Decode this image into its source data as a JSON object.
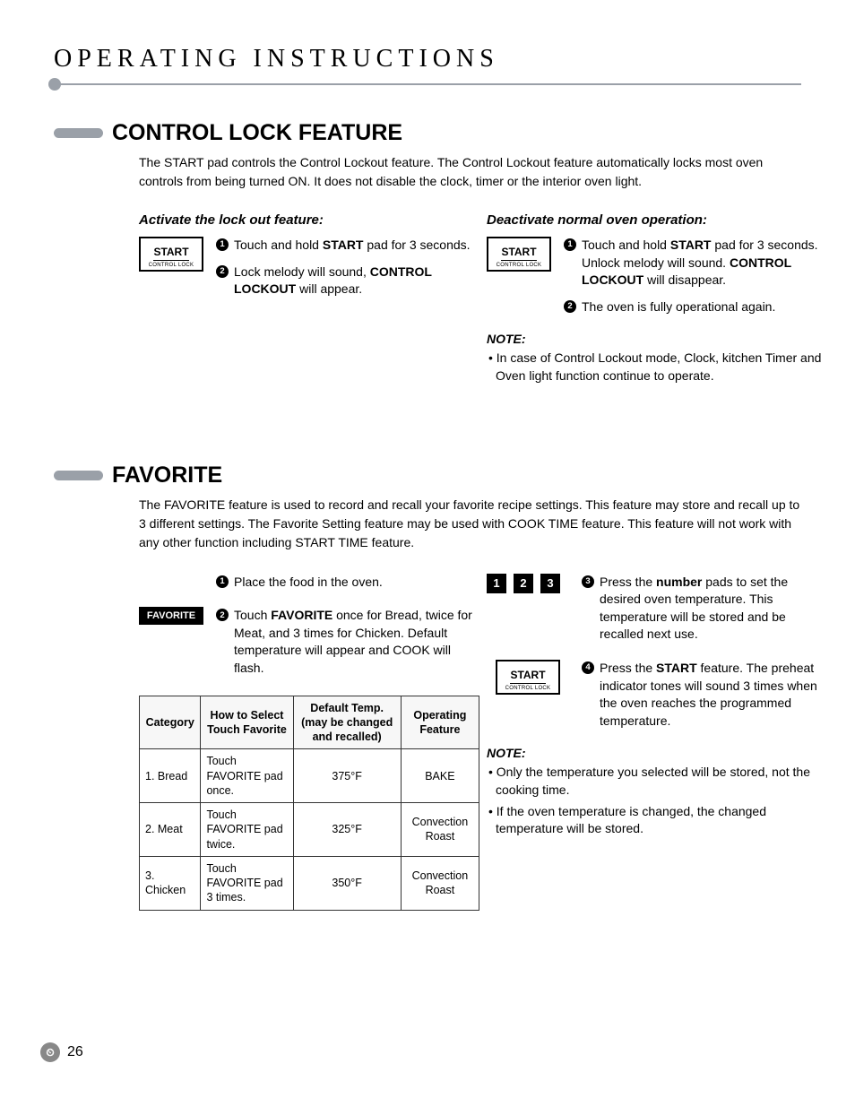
{
  "page_title": "OPERATING INSTRUCTIONS",
  "page_number": "26",
  "logo_glyph": "⏲",
  "section1": {
    "heading": "CONTROL LOCK FEATURE",
    "intro": "The START pad controls the Control Lockout feature. The Control Lockout feature automatically locks most oven controls from being turned ON. It does not disable the clock, timer or the interior oven light.",
    "left": {
      "subheading": "Activate the lock out feature:",
      "pad_main": "START",
      "pad_sub": "CONTROL LOCK",
      "step1_a": "Touch and hold ",
      "step1_b": "START",
      "step1_c": " pad for 3 seconds.",
      "step2_a": "Lock melody will sound, ",
      "step2_b": "CONTROL LOCKOUT",
      "step2_c": " will appear."
    },
    "right": {
      "subheading": "Deactivate normal oven operation:",
      "pad_main": "START",
      "pad_sub": "CONTROL LOCK",
      "step1_a": "Touch and hold ",
      "step1_b": "START",
      "step1_c": " pad for 3 seconds. Unlock melody will sound. ",
      "step1_d": "CONTROL LOCKOUT",
      "step1_e": " will disappear.",
      "step2": "The oven is fully operational again.",
      "note_label": "NOTE:",
      "note": "• In case of Control Lockout mode, Clock, kitchen Timer and Oven light function continue to operate."
    }
  },
  "section2": {
    "heading": "FAVORITE",
    "intro": "The FAVORITE feature is used to record and recall your favorite recipe settings. This feature may store and recall up to 3 different settings. The Favorite Setting feature may be used with COOK TIME feature. This feature will not work with any other function including START TIME feature.",
    "left": {
      "fav_pad": "FAVORITE",
      "step1": "Place the food in the oven.",
      "step2_a": "Touch ",
      "step2_b": "FAVORITE",
      "step2_c": " once for Bread, twice for Meat, and 3 times for Chicken. Default temperature will appear and COOK will flash."
    },
    "table": {
      "headers": [
        "Category",
        "How to Select Touch Favorite",
        "Default Temp. (may be changed and recalled)",
        "Operating Feature"
      ],
      "rows": [
        [
          "1. Bread",
          "Touch FAVORITE pad once.",
          "375°F",
          "BAKE"
        ],
        [
          "2. Meat",
          "Touch FAVORITE pad twice.",
          "325°F",
          "Convection Roast"
        ],
        [
          "3. Chicken",
          "Touch FAVORITE pad 3 times.",
          "350°F",
          "Convection Roast"
        ]
      ]
    },
    "right": {
      "nums": [
        "1",
        "2",
        "3"
      ],
      "step3_a": "Press the ",
      "step3_b": "number",
      "step3_c": " pads to set the desired oven temperature. This temperature will be stored and be recalled next use.",
      "pad_main": "START",
      "pad_sub": "CONTROL LOCK",
      "step4_a": "Press the ",
      "step4_b": "START",
      "step4_c": " feature.  The preheat indicator tones will sound 3 times when the oven reaches the programmed temperature.",
      "note_label": "NOTE:",
      "note1": "• Only the temperature you selected will be stored, not the cooking time.",
      "note2": "• If the oven temperature is changed, the changed temperature will be stored."
    }
  }
}
